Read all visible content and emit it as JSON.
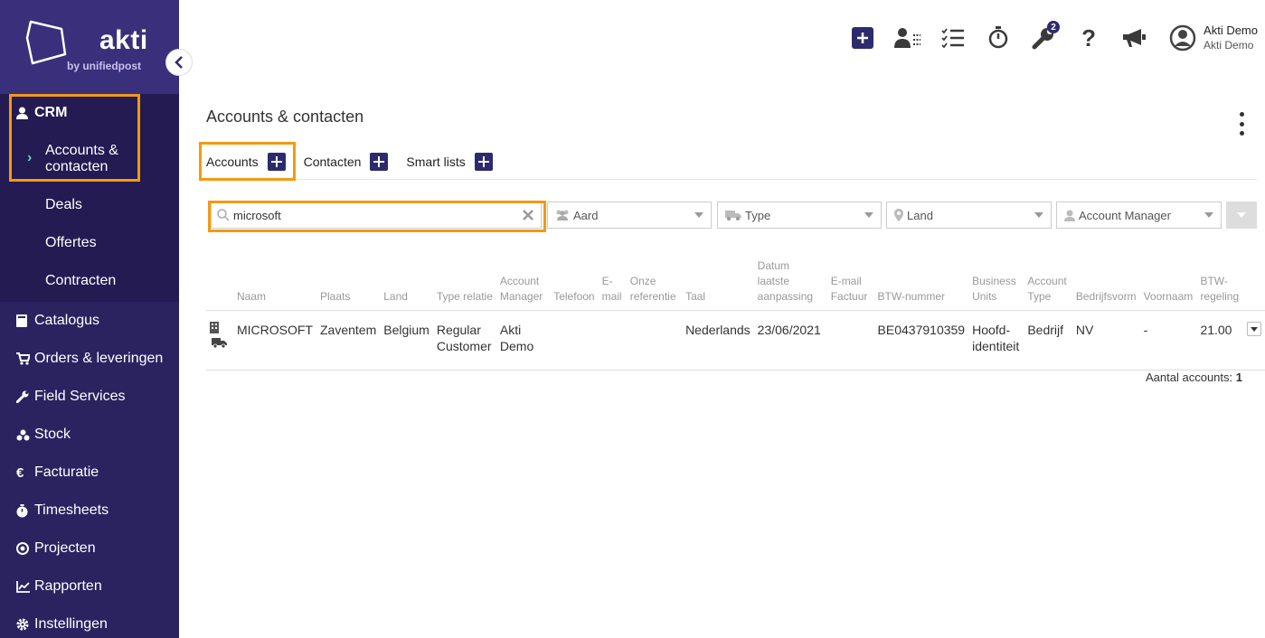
{
  "brand": {
    "name": "akti",
    "tagline": "by unifiedpost"
  },
  "sidebar": {
    "crm": {
      "label": "CRM",
      "icon": "user-icon"
    },
    "crm_items": [
      {
        "label": "Accounts & contacten",
        "active": true
      },
      {
        "label": "Deals"
      },
      {
        "label": "Offertes"
      },
      {
        "label": "Contracten"
      }
    ],
    "items": [
      {
        "label": "Catalogus",
        "icon": "book-icon"
      },
      {
        "label": "Orders & leveringen",
        "icon": "cart-icon"
      },
      {
        "label": "Field Services",
        "icon": "wrench-icon"
      },
      {
        "label": "Stock",
        "icon": "boxes-icon"
      },
      {
        "label": "Facturatie",
        "icon": "euro-icon"
      },
      {
        "label": "Timesheets",
        "icon": "stopwatch-icon"
      },
      {
        "label": "Projecten",
        "icon": "target-icon"
      },
      {
        "label": "Rapporten",
        "icon": "chart-icon"
      },
      {
        "label": "Instellingen",
        "icon": "gear-icon"
      }
    ]
  },
  "topbar": {
    "notification_count": "2",
    "user_name": "Akti Demo",
    "user_company": "Akti Demo"
  },
  "page": {
    "title": "Accounts & contacten",
    "tabs": [
      {
        "label": "Accounts"
      },
      {
        "label": "Contacten"
      },
      {
        "label": "Smart lists"
      }
    ]
  },
  "filters": {
    "search_value": "microsoft",
    "aard": "Aard",
    "type": "Type",
    "land": "Land",
    "account_manager": "Account Manager"
  },
  "table": {
    "headers": [
      "Naam",
      "Plaats",
      "Land",
      "Type relatie",
      "Account Manager",
      "Telefoon",
      "E-mail",
      "Onze referentie",
      "Taal",
      "Datum laatste aanpassing",
      "E-mail Factuur",
      "BTW-nummer",
      "Business Units",
      "Account Type",
      "Bedrijfsvorm",
      "Voornaam",
      "BTW-regeling"
    ],
    "rows": [
      {
        "naam": "MICROSOFT",
        "plaats": "Zaventem",
        "land": "Belgium",
        "type_relatie": "Regular Customer",
        "account_manager": "Akti Demo",
        "telefoon": "",
        "email": "",
        "referentie": "",
        "taal": "Nederlands",
        "datum": "23/06/2021",
        "email_factuur": "",
        "btw_nummer": "BE0437910359",
        "business_units": "Hoofd-identiteit",
        "account_type": "Bedrijf",
        "bedrijfsvorm": "NV",
        "voornaam": "-",
        "btw_regeling": "21.00"
      }
    ]
  },
  "footer": {
    "count_label": "Aantal accounts:",
    "count_value": "1"
  },
  "colors": {
    "sidebar": "#2b2360",
    "accent": "#2e2a6e",
    "highlight": "#f39a11",
    "active_chevron": "#5fd9c6"
  }
}
